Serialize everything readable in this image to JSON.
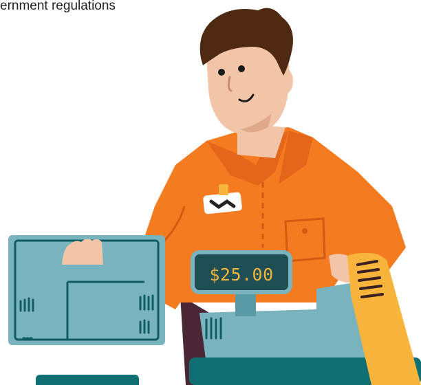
{
  "caption": {
    "text": "ernment regulations"
  },
  "register_display": {
    "price": "$25.00"
  },
  "colors": {
    "shirt": "#f47b20",
    "skin": "#f2c4a8",
    "hair": "#4e2a12",
    "machine": "#79b3bd",
    "outline": "#0f5c63",
    "receipt": "#f9b43b",
    "display_bg": "#1f4e55",
    "pants": "#4a2737",
    "stand": "#0f6f73"
  }
}
